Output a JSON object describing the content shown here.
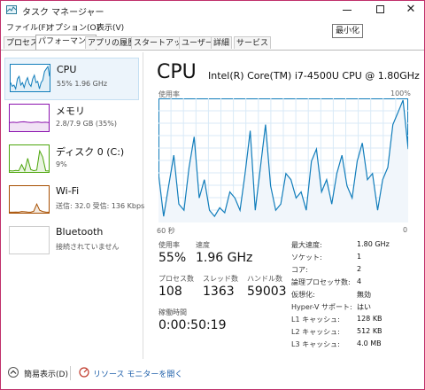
{
  "window": {
    "title": "タスク マネージャー",
    "tooltip": "最小化",
    "close_glyph": "✕"
  },
  "menu": [
    "ファイル(F)",
    "オプション(O)",
    "表示(V)"
  ],
  "tabs": [
    "プロセス",
    "パフォーマンス",
    "アプリの履歴",
    "スタートアップ",
    "ユーザー",
    "詳細",
    "サービス"
  ],
  "active_tab": 1,
  "sidebar": {
    "items": [
      {
        "title": "CPU",
        "sub": "55%  1.96 GHz",
        "color": "#117dbb"
      },
      {
        "title": "メモリ",
        "sub": "2.8/7.9 GB (35%)",
        "color": "#8b12ae"
      },
      {
        "title": "ディスク 0 (C:)",
        "sub": "9%",
        "color": "#4da60c"
      },
      {
        "title": "Wi-Fi",
        "sub": "送信: 32.0 受信: 136 Kbps",
        "color": "#a74f01"
      },
      {
        "title": "Bluetooth",
        "sub": "接続されていません",
        "color": "#cccccc"
      }
    ]
  },
  "main": {
    "title": "CPU",
    "cpu_name": "Intel(R) Core(TM) i7-4500U CPU @ 1.80GHz",
    "usage_label": "使用率",
    "max_label": "100%",
    "time_label": "60 秒",
    "zero_label": "0",
    "stats": {
      "usage_label": "使用率",
      "usage_value": "55%",
      "speed_label": "速度",
      "speed_value": "1.96 GHz",
      "processes_label": "プロセス数",
      "processes_value": "108",
      "threads_label": "スレッド数",
      "threads_value": "1363",
      "handles_label": "ハンドル数",
      "handles_value": "59003",
      "uptime_label": "稼働時間",
      "uptime_value": "0:00:50:19"
    },
    "specs": [
      {
        "k": "最大速度:",
        "v": "1.80 GHz"
      },
      {
        "k": "ソケット:",
        "v": "1"
      },
      {
        "k": "コア:",
        "v": "2"
      },
      {
        "k": "論理プロセッサ数:",
        "v": "4"
      },
      {
        "k": "仮想化:",
        "v": "無効"
      },
      {
        "k": "Hyper-V サポート:",
        "v": "はい"
      },
      {
        "k": "L1 キャッシュ:",
        "v": "128 KB"
      },
      {
        "k": "L2 キャッシュ:",
        "v": "512 KB"
      },
      {
        "k": "L3 キャッシュ:",
        "v": "4.0 MB"
      }
    ],
    "graph_color": "#117dbb",
    "graph_values": [
      0.4,
      0.05,
      0.3,
      0.55,
      0.15,
      0.1,
      0.45,
      0.7,
      0.2,
      0.35,
      0.1,
      0.05,
      0.12,
      0.08,
      0.25,
      0.2,
      0.1,
      0.4,
      0.75,
      0.1,
      0.45,
      0.8,
      0.3,
      0.1,
      0.15,
      0.4,
      0.35,
      0.2,
      0.25,
      0.1,
      0.5,
      0.6,
      0.25,
      0.35,
      0.15,
      0.4,
      0.55,
      0.3,
      0.2,
      0.5,
      0.65,
      0.35,
      0.4,
      0.1,
      0.35,
      0.45,
      0.8,
      0.9,
      1.0,
      0.6
    ]
  },
  "footer": {
    "less_detail": "簡易表示(D)",
    "resource_monitor": "リソース モニターを開く"
  }
}
